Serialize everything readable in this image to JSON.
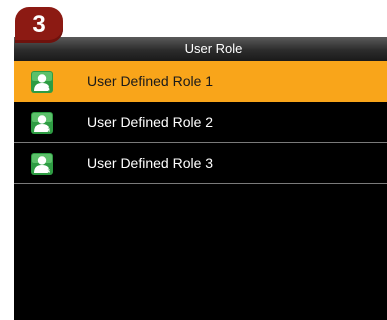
{
  "step_badge": "3",
  "header": {
    "title": "User Role"
  },
  "roles": [
    {
      "label": "User Defined Role 1",
      "icon": "user-role-1-icon",
      "selected": true
    },
    {
      "label": "User Defined Role 2",
      "icon": "user-role-2-icon",
      "selected": false
    },
    {
      "label": "User Defined Role 3",
      "icon": "user-role-3-icon",
      "selected": false
    }
  ],
  "colors": {
    "selection": "#f9a51a",
    "badge": "#8c1a13",
    "icon_green": "#2e9c43",
    "background": "#000000"
  }
}
